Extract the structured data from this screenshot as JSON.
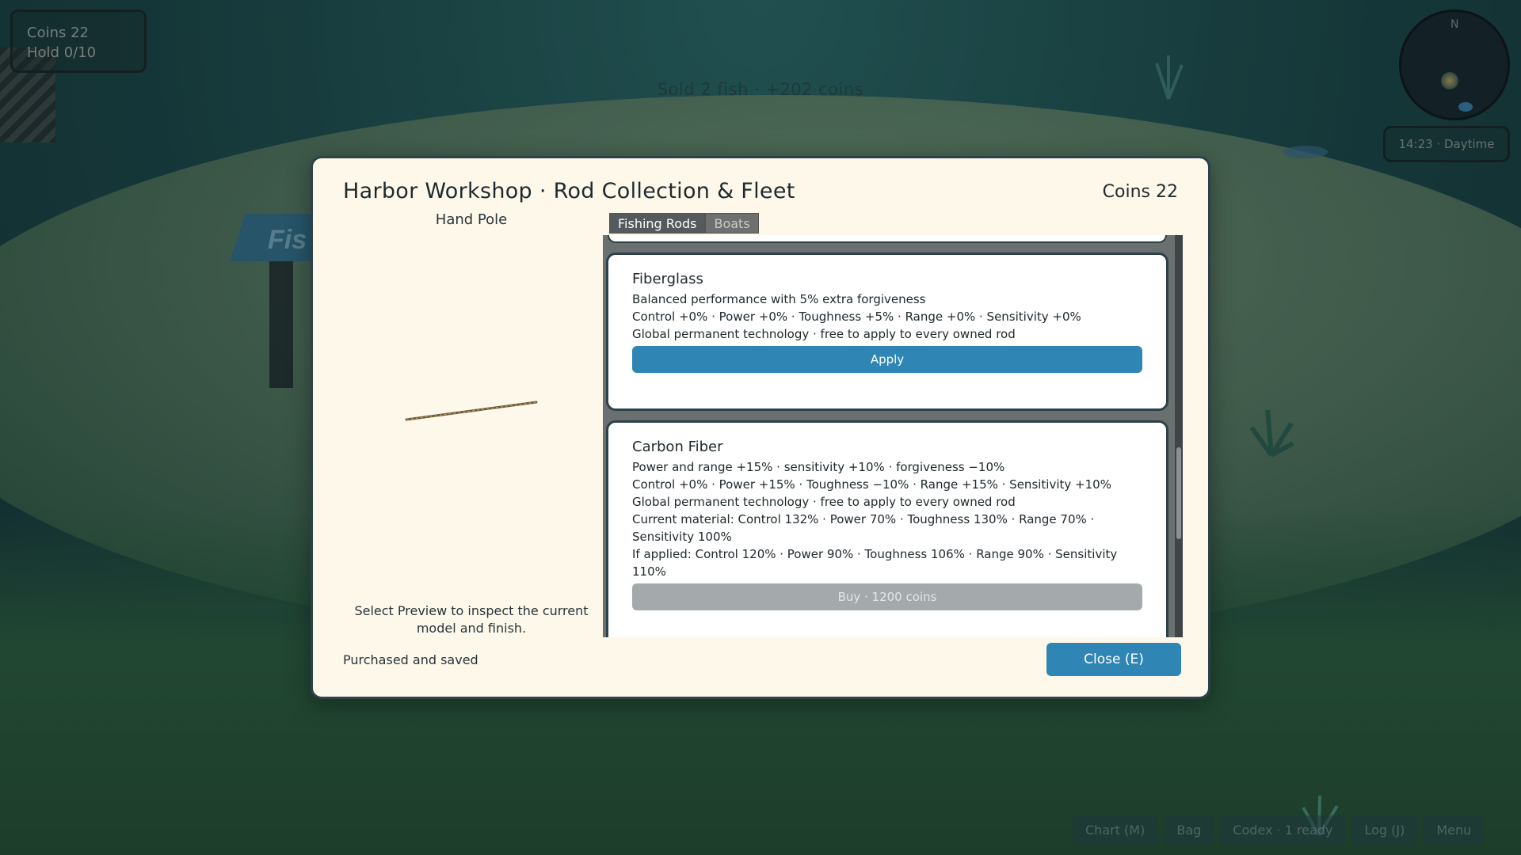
{
  "hud": {
    "coins": "Coins 22",
    "hold": "Hold 0/10",
    "toast": "Sold 2 fish · +202 coins",
    "compass_north": "N",
    "clock": "14:23 · Daytime",
    "hut_sign": "Fis",
    "bottom_buttons": [
      "Chart (M)",
      "Bag",
      "Codex · 1 ready",
      "Log (J)",
      "Menu"
    ]
  },
  "modal": {
    "title": "Harbor Workshop · Rod Collection & Fleet",
    "coins": "Coins 22",
    "preview": {
      "name": "Hand Pole",
      "hint": "Select Preview to inspect the current model and finish."
    },
    "tabs": [
      {
        "label": "Fishing Rods",
        "active": true
      },
      {
        "label": "Boats",
        "active": false
      }
    ],
    "materials": [
      {
        "name": "Fiberglass",
        "lines": [
          "Balanced performance with 5% extra forgiveness",
          "Control +0% · Power +0% · Toughness +5% · Range +0% · Sensitivity +0%",
          "Global permanent technology · free to apply to every owned rod"
        ],
        "button": "Apply",
        "button_state": "enabled"
      },
      {
        "name": "Carbon Fiber",
        "lines": [
          "Power and range +15% · sensitivity +10% · forgiveness −10%",
          "Control +0% · Power +15% · Toughness −10% · Range +15% · Sensitivity +10%",
          "Global permanent technology · free to apply to every owned rod",
          "Current material: Control 132% · Power 70% · Toughness 130% · Range 70% · Sensitivity 100%",
          "If applied: Control 120% · Power 90% · Toughness 106% · Range 90% · Sensitivity 110%"
        ],
        "button": "Buy · 1200 coins",
        "button_state": "disabled"
      }
    ],
    "scroll_position": 0.55,
    "status": "Purchased and saved",
    "close": "Close (E)"
  },
  "colors": {
    "panel_bg": "#fdf8ea",
    "accent": "#2f86b5",
    "border": "#2c4248",
    "disabled": "#a4a9ab"
  }
}
